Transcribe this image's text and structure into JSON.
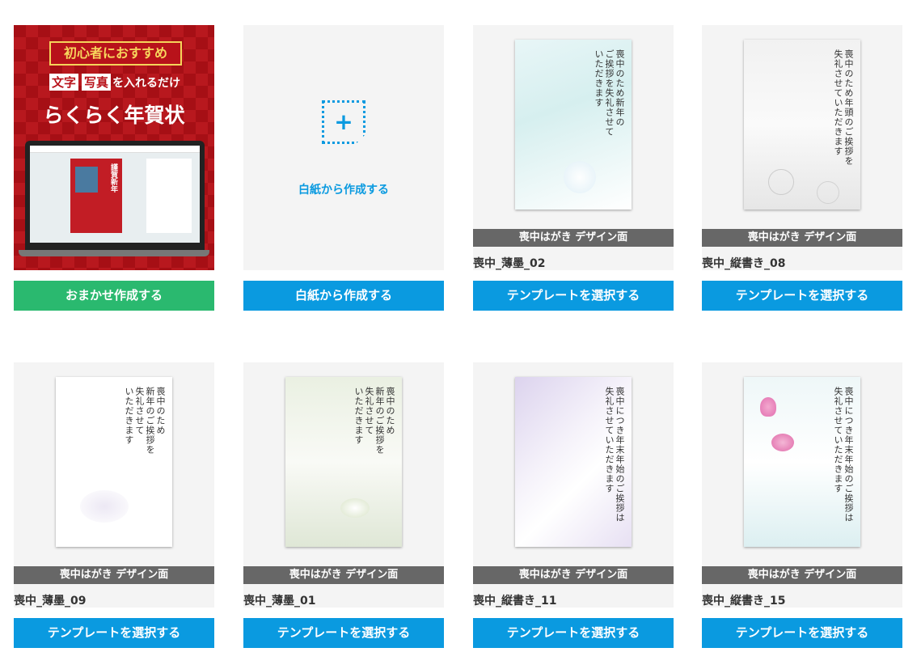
{
  "cards": [
    {
      "promo": {
        "top": "初心者におすすめ",
        "word1": "文字",
        "word2": "写真",
        "mid_rest": "を入れるだけ",
        "title": "らくらく年賀状",
        "screen_card": "謹賀新年"
      },
      "button": "おまかせ作成する",
      "button_color": "#2ab96f"
    },
    {
      "blank_label": "白紙から作成する",
      "button": "白紙から作成する"
    },
    {
      "badge": "喪中はがき デザイン面",
      "name": "喪中_薄墨_02",
      "button": "テンプレートを選択する",
      "postcard": {
        "heading": "喪中のため新年の\nご挨拶を失礼させて\nいただきます"
      }
    },
    {
      "badge": "喪中はがき デザイン面",
      "name": "喪中_縦書き_08",
      "button": "テンプレートを選択する",
      "postcard": {
        "heading": "喪中のため年頭のご挨拶を\n失礼させていただきます"
      }
    },
    {
      "badge": "喪中はがき デザイン面",
      "name": "喪中_薄墨_09",
      "button": "テンプレートを選択する",
      "postcard": {
        "heading": "喪中のため\n新年のご挨拶を\n失礼させて\nいただきます"
      }
    },
    {
      "badge": "喪中はがき デザイン面",
      "name": "喪中_薄墨_01",
      "button": "テンプレートを選択する",
      "postcard": {
        "heading": "喪中のため\n新年のご挨拶を\n失礼させて\nいただきます"
      }
    },
    {
      "badge": "喪中はがき デザイン面",
      "name": "喪中_縦書き_11",
      "button": "テンプレートを選択する",
      "postcard": {
        "heading": "喪中につき年末年始のご挨拶は\n失礼させていただきます"
      }
    },
    {
      "badge": "喪中はがき デザイン面",
      "name": "喪中_縦書き_15",
      "button": "テンプレートを選択する",
      "postcard": {
        "heading": "喪中につき年末年始のご挨拶は\n失礼させていただきます"
      }
    }
  ],
  "colors": {
    "primary_button": "#0a9ae0",
    "badge_bg": "#676767",
    "thumb_bg": "#f4f4f4"
  },
  "icons": {
    "blank": "plus-icon"
  }
}
